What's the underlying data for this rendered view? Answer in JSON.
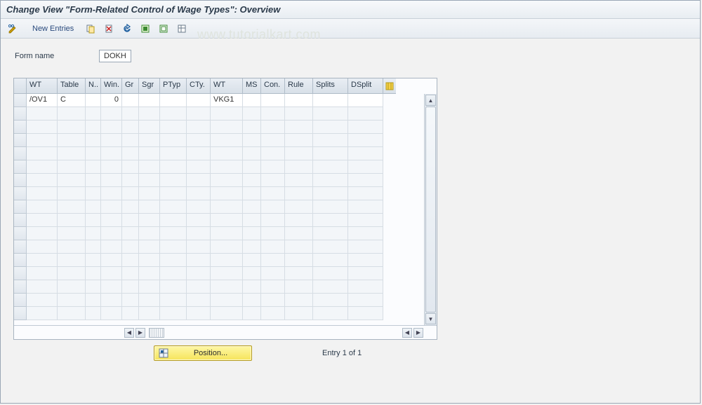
{
  "title": "Change View \"Form-Related Control of Wage Types\": Overview",
  "watermark": "www.tutorialkart.com",
  "toolbar": {
    "new_entries_label": "New Entries"
  },
  "form": {
    "name_label": "Form name",
    "name_value": "DOKH"
  },
  "grid": {
    "columns": [
      "WT",
      "Table",
      "N..",
      "Win.",
      "Gr",
      "Sgr",
      "PTyp",
      "CTy.",
      "WT",
      "MS",
      "Con.",
      "Rule",
      "Splits",
      "DSplit"
    ],
    "rows": [
      {
        "wt1": "/OV1",
        "table": "C",
        "n": "",
        "win": "0",
        "gr": "",
        "sgr": "",
        "ptyp": "",
        "cty": "",
        "wt2": "VKG1",
        "ms": "",
        "con": "",
        "rule": "",
        "splits": "",
        "dsplit": ""
      }
    ],
    "empty_row_count": 16
  },
  "footer": {
    "position_label": "Position...",
    "entry_text": "Entry 1 of 1"
  }
}
